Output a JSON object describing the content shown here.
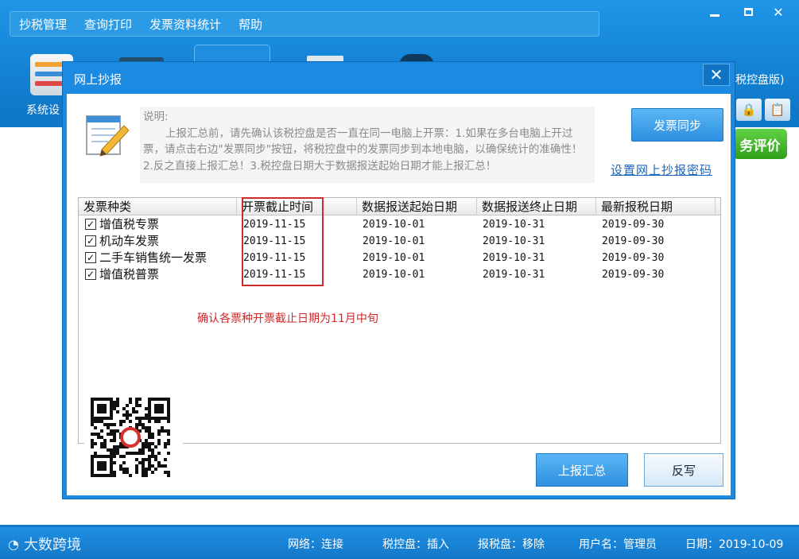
{
  "menu": [
    "抄税管理",
    "查询打印",
    "发票资料统计",
    "帮助"
  ],
  "toolbar": {
    "first_label": "系统设"
  },
  "side": {
    "title_fragment": "税控盘版)",
    "eval_badge": "务评价"
  },
  "dialog": {
    "title": "网上抄报",
    "close_label": "✕",
    "description_title": "说明:",
    "description_body": "上报汇总前，请先确认该税控盘是否一直在同一电脑上开票：1.如果在多台电脑上开过票，请点击右边\"发票同步\"按钮，将税控盘中的发票同步到本地电脑，以确保统计的准确性！2.反之直接上报汇总！3.税控盘日期大于数据报送起始日期才能上报汇总！",
    "sync_button": "发票同步",
    "password_link": "设置网上抄报密码",
    "annotation": "确认各票种开票截止日期为11月中旬",
    "report_button": "上报汇总",
    "writeback_button": "反写"
  },
  "table": {
    "columns": [
      "发票种类",
      "开票截止时间",
      "数据报送起始日期",
      "数据报送终止日期",
      "最新报税日期"
    ],
    "rows": [
      {
        "checked": true,
        "type": "增值税专票",
        "deadline": "2019-11-15",
        "start": "2019-10-01",
        "end": "2019-10-31",
        "latest": "2019-09-30"
      },
      {
        "checked": true,
        "type": "机动车发票",
        "deadline": "2019-11-15",
        "start": "2019-10-01",
        "end": "2019-10-31",
        "latest": "2019-09-30"
      },
      {
        "checked": true,
        "type": "二手车销售统一发票",
        "deadline": "2019-11-15",
        "start": "2019-10-01",
        "end": "2019-10-31",
        "latest": "2019-09-30"
      },
      {
        "checked": true,
        "type": "增值税普票",
        "deadline": "2019-11-15",
        "start": "2019-10-01",
        "end": "2019-10-31",
        "latest": "2019-09-30"
      }
    ]
  },
  "status": {
    "logo_text": "大数跨境",
    "network": "网络：连接",
    "tax_disk": "税控盘：插入",
    "report_disk": "报税盘：移除",
    "user": "用户名：管理员",
    "date": "日期：2019-10-09"
  },
  "colors": {
    "accent": "#1b8ae0",
    "annotation_red": "#d3282a",
    "link": "#1a67c2"
  }
}
